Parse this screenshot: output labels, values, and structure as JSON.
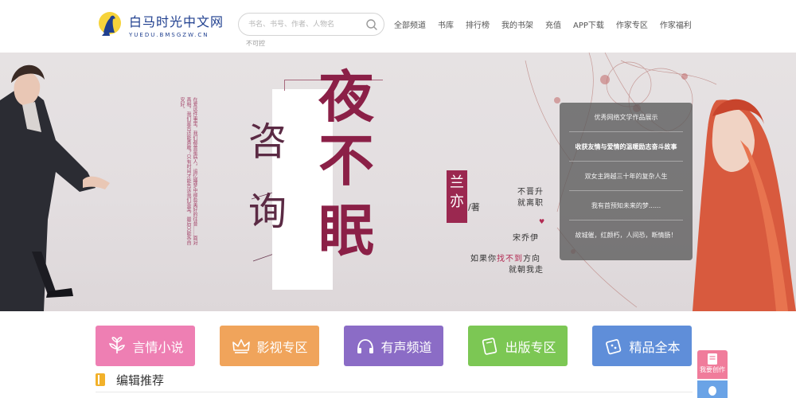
{
  "brand": {
    "name_cn": "白马时光中文网",
    "name_en": "YUEDU.BMSGZW.CN"
  },
  "search": {
    "placeholder": "书名、书号、作者、人物名",
    "hint": "不可控"
  },
  "nav": {
    "items": [
      "全部频道",
      "书库",
      "排行榜",
      "我的书架",
      "充值",
      "APP下载",
      "作家专区",
      "作家福利"
    ]
  },
  "banner": {
    "title_small": [
      "咨",
      "询"
    ],
    "title_big": [
      "夜",
      "不",
      "眠"
    ],
    "author": [
      "兰",
      "亦"
    ],
    "author_suffix": "/著",
    "slogan1": "不晋升",
    "slogan2": "就离职",
    "heart": "♥",
    "slogan3": "宋乔伊",
    "slogan4a": "如果你",
    "slogan4b": "找不到",
    "slogan4c": "方向",
    "slogan5": "就朝我走",
    "poem": "在爱这件事里，我们都曾是病人，追忆睡梦中那些美好的往昔……面对真相，我们是否还能勇敢？只有时间才能告诉我们答案，最后只能各自安好。"
  },
  "banner_list": [
    {
      "text": "优秀网络文学作品展示",
      "active": false
    },
    {
      "text": "收获友情与爱情的温暖励志奋斗故事",
      "active": true
    },
    {
      "text": "双女主跨越三十年的复杂人生",
      "active": false
    },
    {
      "text": "我有首预知未来的梦......",
      "active": false
    },
    {
      "text": "故城催，红颜朽，人间恐，断情肠！",
      "active": false
    }
  ],
  "channels": [
    {
      "label": "言情小说",
      "color": "#ee7fb3",
      "icon": "flower-icon"
    },
    {
      "label": "影视专区",
      "color": "#f0a45b",
      "icon": "crown-icon"
    },
    {
      "label": "有声频道",
      "color": "#8b6cc6",
      "icon": "headphones-icon"
    },
    {
      "label": "出版专区",
      "color": "#7cc754",
      "icon": "book-icon"
    },
    {
      "label": "精品全本",
      "color": "#5f8ed9",
      "icon": "gift-icon"
    }
  ],
  "section": {
    "title": "编辑推荐"
  },
  "float": {
    "write": "我要创作"
  },
  "colors": {
    "brand": "#1f3f8f",
    "accent": "#9b2850",
    "panel": "#5a5a5a"
  }
}
